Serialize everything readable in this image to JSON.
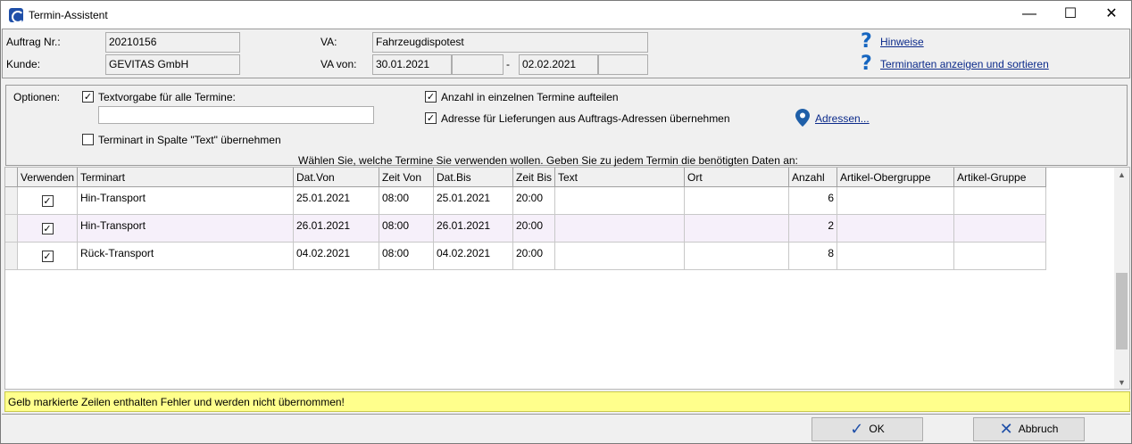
{
  "window": {
    "title": "Termin-Assistent",
    "minimize": "—",
    "maximize": "☐",
    "close": "✕"
  },
  "header": {
    "auftrag_label": "Auftrag Nr.:",
    "auftrag_value": "20210156",
    "kunde_label": "Kunde:",
    "kunde_value": "GEVITAS GmbH",
    "va_label": "VA:",
    "va_value": "Fahrzeugdispotest",
    "va_von_label": "VA von:",
    "va_von_date": "30.01.2021",
    "va_von_time": "",
    "dash": "-",
    "va_bis_date": "02.02.2021",
    "va_bis_time": "",
    "hinweise": "Hinweise",
    "terminarten": "Terminarten anzeigen und sortieren"
  },
  "options": {
    "label": "Optionen:",
    "textvorgabe_label": "Textvorgabe für alle Termine:",
    "textvorgabe_checked": true,
    "textvorgabe_value": "",
    "terminart_label": "Terminart in Spalte \"Text\" übernehmen",
    "terminart_checked": false,
    "anzahl_label": "Anzahl in einzelnen Termine aufteilen",
    "anzahl_checked": true,
    "adresse_label": "Adresse für Lieferungen aus Auftrags-Adressen übernehmen",
    "adresse_checked": true,
    "adressen_link": "Adressen...",
    "instruction": "Wählen Sie, welche Termine Sie verwenden wollen. Geben Sie zu jedem Termin die benötigten Daten an:"
  },
  "table": {
    "columns": [
      "Verwenden",
      "Terminart",
      "Dat.Von",
      "Zeit Von",
      "Dat.Bis",
      "Zeit Bis",
      "Text",
      "Ort",
      "Anzahl",
      "Artikel-Obergruppe",
      "Artikel-Gruppe"
    ],
    "rows": [
      {
        "verwenden": "✓",
        "terminart": "Hin-Transport",
        "dat_von": "25.01.2021",
        "zeit_von": "08:00",
        "dat_bis": "25.01.2021",
        "zeit_bis": "20:00",
        "text": "",
        "ort": "",
        "anzahl": "6",
        "obergruppe": "",
        "gruppe": ""
      },
      {
        "verwenden": "✓",
        "terminart": "Hin-Transport",
        "dat_von": "26.01.2021",
        "zeit_von": "08:00",
        "dat_bis": "26.01.2021",
        "zeit_bis": "20:00",
        "text": "",
        "ort": "",
        "anzahl": "2",
        "obergruppe": "",
        "gruppe": ""
      },
      {
        "verwenden": "✓",
        "terminart": "Rück-Transport",
        "dat_von": "04.02.2021",
        "zeit_von": "08:00",
        "dat_bis": "04.02.2021",
        "zeit_bis": "20:00",
        "text": "",
        "ort": "",
        "anzahl": "8",
        "obergruppe": "",
        "gruppe": ""
      }
    ]
  },
  "status": "Gelb markierte Zeilen enthalten Fehler und werden nicht übernommen!",
  "buttons": {
    "ok": "OK",
    "ok_icon": "✓",
    "abbruch": "Abbruch",
    "abbruch_icon": "✕"
  },
  "colors": {
    "accent_link": "#0b2a8a",
    "help_icon": "#1565c0",
    "status_bg": "#ffff8c",
    "row_alt": "#f6f0fa"
  }
}
